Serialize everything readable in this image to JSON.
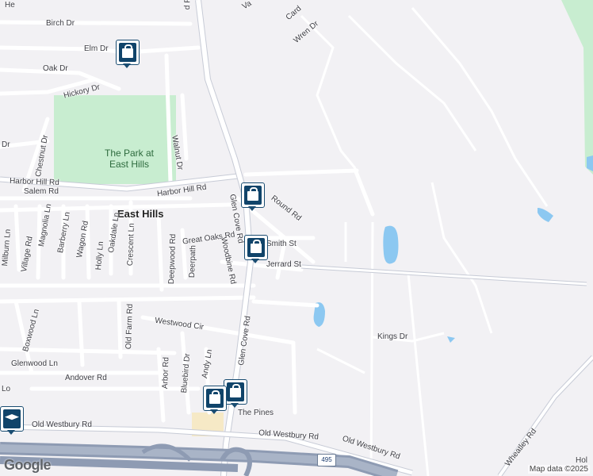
{
  "map": {
    "town_label": "East Hills",
    "park_label_line1": "The Park at",
    "park_label_line2": "East Hills",
    "highway_shield": "495",
    "attribution": "Map data ©2025",
    "logo": "Google",
    "colors": {
      "background": "#f2f1f4",
      "road": "#ffffff",
      "road_outline": "#d6d5de",
      "major_road": "#c7cbd6",
      "park": "#c8edd0",
      "water": "#8cc8f1",
      "highway": "#8e9bb3",
      "pin": "#10446a",
      "commercial": "#f6e9c6"
    },
    "streets": {
      "birch": "Birch Dr",
      "elm": "Elm Dr",
      "oak": "Oak Dr",
      "hickory": "Hickory Dr",
      "walnut": "Walnut Dr",
      "chestnut": "Chestnut Dr",
      "dr": "Dr",
      "harbor_hill_left": "Harbor Hill Rd",
      "harbor_hill_right": "Harbor Hill Rd",
      "salem": "Salem Rd",
      "magnolia": "Magnolia Ln",
      "barberry": "Barberry Ln",
      "wagon": "Wagon Rd",
      "holly": "Holly Ln",
      "oakdale": "Oakdale Ln",
      "crescent": "Crescent Ln",
      "village": "Village Rd",
      "milburn": "Milburn Ln",
      "great_oaks": "Great Oaks Rd",
      "deepwood": "Deepwood Rd",
      "deerpath": "Deerpath",
      "woodbine": "Woodbine Rd",
      "glen_cove_upper": "Glen Cove Rd",
      "glen_cove_lower": "Glen Cove Rd",
      "round": "Round Rd",
      "smith": "Smith St",
      "jerrard": "Jerrard St",
      "boxwood": "Boxwood Ln",
      "old_farm": "Old Farm Rd",
      "westwood": "Westwood Cir",
      "glenwood": "Glenwood Ln",
      "arbor": "Arbor Rd",
      "bluebird": "Bluebird Dr",
      "andy": "Andy Ln",
      "andover": "Andover Rd",
      "the_pines": "The Pines",
      "kings": "Kings Dr",
      "old_westbury_1": "Old Westbury Rd",
      "old_westbury_2": "Old Westbury Rd",
      "old_westbury_3": "Old Westbury Rd",
      "wheatley": "Wheatley Rd",
      "wren": "Wren Dr",
      "card": "Card",
      "valley": "Va",
      "top_rd": "d Rd",
      "he": "He",
      "lo": "Lo",
      "hol": "Hol"
    },
    "pins": [
      {
        "icon": "shopping-bag-icon"
      },
      {
        "icon": "shopping-bag-icon"
      },
      {
        "icon": "shopping-bag-icon"
      },
      {
        "icon": "shopping-bag-icon"
      },
      {
        "icon": "shopping-bag-icon"
      },
      {
        "icon": "graduation-cap-icon"
      }
    ]
  }
}
